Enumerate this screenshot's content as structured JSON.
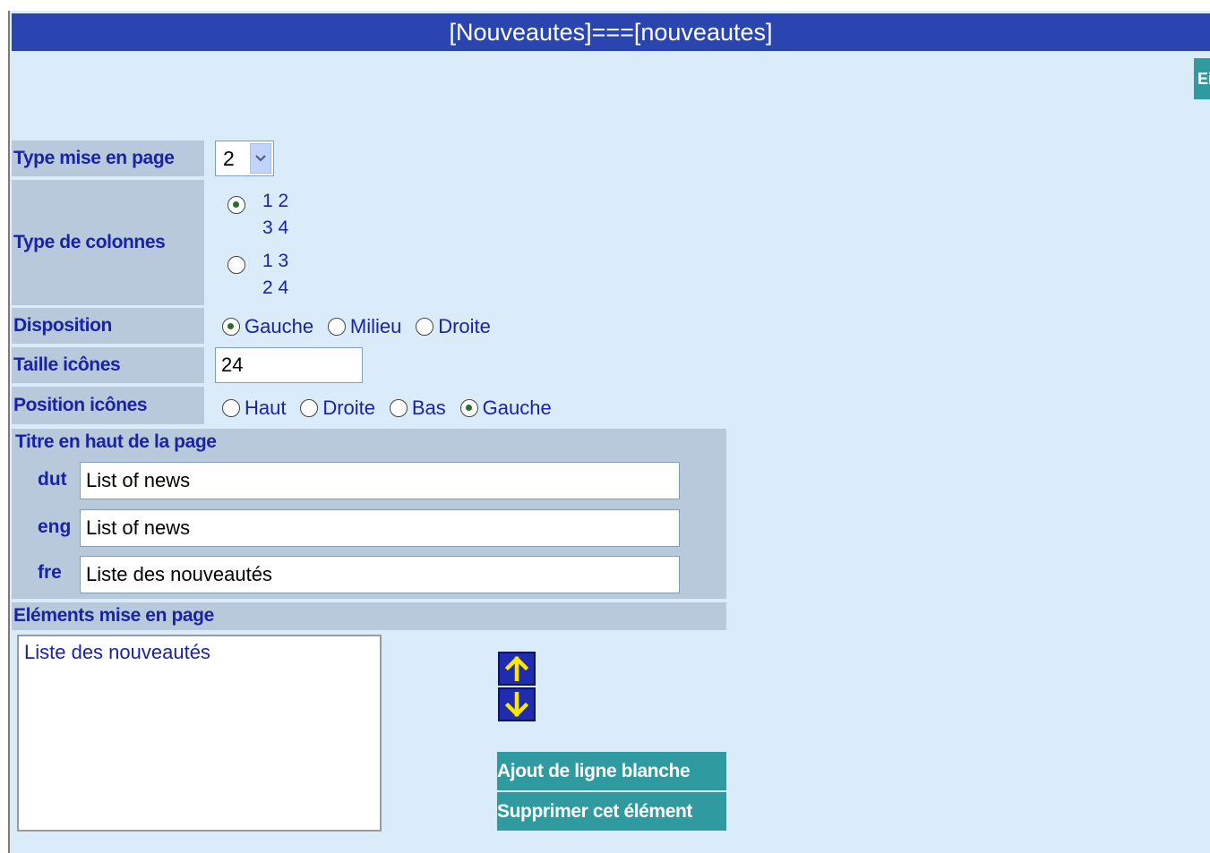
{
  "window": {
    "title": "[Nouveautes]===[nouveautes]",
    "top_button_label": "Ei"
  },
  "form": {
    "layout_type": {
      "label": "Type mise en page",
      "value": "2"
    },
    "column_type": {
      "label": "Type de colonnes",
      "options": [
        {
          "line1": "1 2",
          "line2": "3 4",
          "selected": true
        },
        {
          "line1": "1 3",
          "line2": "2 4",
          "selected": false
        }
      ]
    },
    "disposition": {
      "label": "Disposition",
      "options": [
        {
          "label": "Gauche",
          "selected": true
        },
        {
          "label": "Milieu",
          "selected": false
        },
        {
          "label": "Droite",
          "selected": false
        }
      ]
    },
    "icon_size": {
      "label": "Taille icônes",
      "value": "24"
    },
    "icon_position": {
      "label": "Position icônes",
      "options": [
        {
          "label": "Haut",
          "selected": false
        },
        {
          "label": "Droite",
          "selected": false
        },
        {
          "label": "Bas",
          "selected": false
        },
        {
          "label": "Gauche",
          "selected": true
        }
      ]
    }
  },
  "page_title": {
    "heading": "Titre en haut de la page",
    "languages": [
      {
        "code": "dut",
        "value": "List of news"
      },
      {
        "code": "eng",
        "value": "List of news"
      },
      {
        "code": "fre",
        "value": "Liste des nouveautés"
      }
    ]
  },
  "layout_elements": {
    "heading": "Eléments mise en page",
    "items": [
      "Liste des nouveautés"
    ],
    "move_up_icon": "arrow-up-icon",
    "move_down_icon": "arrow-down-icon",
    "add_blank_line_label": "Ajout de ligne blanche",
    "delete_element_label": "Supprimer cet élément"
  },
  "colors": {
    "title_bar": "#2b45b0",
    "background": "#daecfa",
    "label_bg": "#b8c9dc",
    "label_text": "#1a23a6",
    "button_bg": "#2f9aa0"
  }
}
